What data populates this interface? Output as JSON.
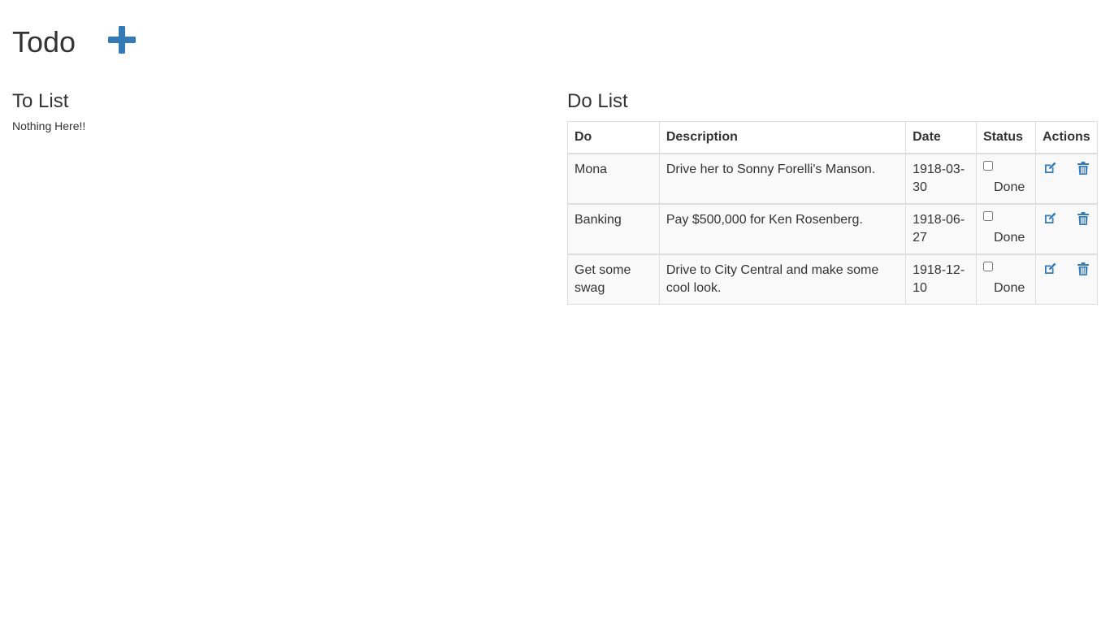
{
  "header": {
    "title": "Todo",
    "add_icon": "plus-icon",
    "accent_color": "#337ab7"
  },
  "to_list": {
    "title": "To List",
    "empty_message": "Nothing Here!!"
  },
  "do_list": {
    "title": "Do List",
    "columns": {
      "do": "Do",
      "description": "Description",
      "date": "Date",
      "status": "Status",
      "actions": "Actions"
    },
    "rows": [
      {
        "do": "Mona",
        "description": "Drive her to Sonny Forelli's Manson.",
        "date": "1918-03-30",
        "status_label": "Done",
        "done": false
      },
      {
        "do": "Banking",
        "description": "Pay $500,000 for Ken Rosenberg.",
        "date": "1918-06-27",
        "status_label": "Done",
        "done": false
      },
      {
        "do": "Get some swag",
        "description": "Drive to City Central and make some cool look.",
        "date": "1918-12-10",
        "status_label": "Done",
        "done": false
      }
    ],
    "action_icons": {
      "edit": "edit-icon",
      "delete": "trash-icon"
    }
  }
}
